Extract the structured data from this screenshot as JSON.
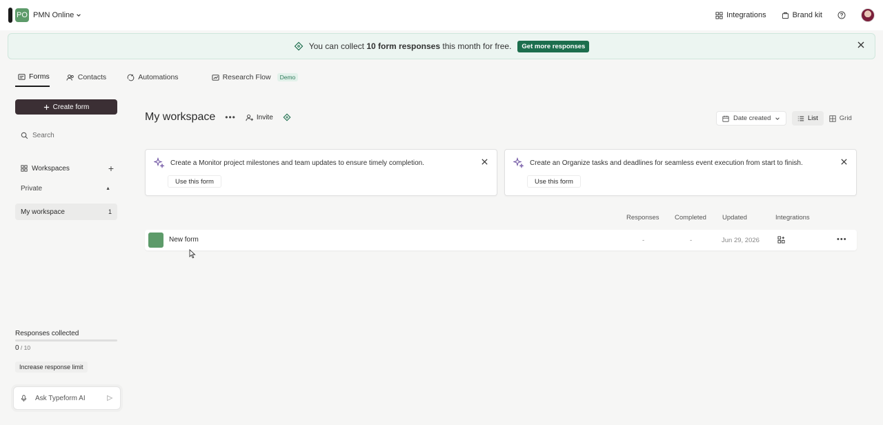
{
  "topbar": {
    "org_initials": "PO",
    "org_name": "PMN Online",
    "integrations": "Integrations",
    "brand_kit": "Brand kit"
  },
  "banner": {
    "text_pre": "You can collect ",
    "text_bold": "10 form responses",
    "text_post": " this month for free.",
    "button": "Get more responses"
  },
  "tabs": [
    {
      "label": "Forms"
    },
    {
      "label": "Contacts"
    },
    {
      "label": "Automations"
    },
    {
      "label": "Research Flow",
      "badge": "Demo"
    }
  ],
  "sidebar": {
    "create_button": "Create form",
    "search_placeholder": "Search",
    "workspaces_label": "Workspaces",
    "private_label": "Private",
    "my_workspace": {
      "label": "My workspace",
      "count": "1"
    },
    "responses_label": "Responses collected",
    "responses_count": "0",
    "responses_limit": " / 10",
    "responses_progress": 0,
    "increase_button": "Increase response limit",
    "ai_placeholder": "Ask Typeform AI"
  },
  "main": {
    "title": "My workspace",
    "invite": "Invite",
    "sort_label": "Date created",
    "view_list": "List",
    "view_grid": "Grid",
    "cards": [
      {
        "text": "Create a Monitor project milestones and team updates to ensure timely completion.",
        "button": "Use this form"
      },
      {
        "text": "Create an Organize tasks and deadlines for seamless event execution from start to finish.",
        "button": "Use this form"
      }
    ],
    "columns": {
      "responses": "Responses",
      "completed": "Completed",
      "updated": "Updated",
      "integrations": "Integrations"
    },
    "forms": [
      {
        "name": "New form",
        "responses": "-",
        "completed": "-",
        "updated": "Jun 29, 2026"
      }
    ]
  },
  "colors": {
    "accent": "#1c6e4d",
    "form_thumb": "#5d9b6a",
    "create_button": "#3b2f34"
  }
}
